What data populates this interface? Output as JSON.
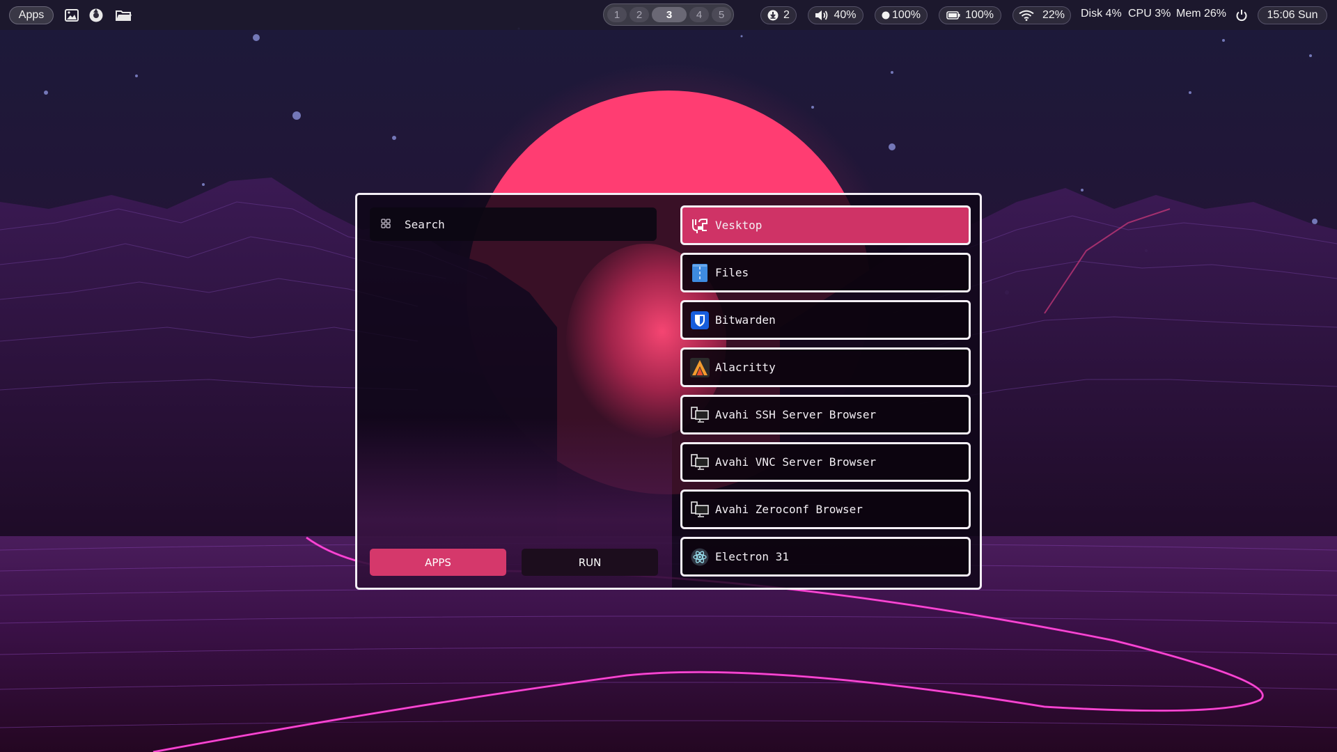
{
  "desktop": {
    "colors": {
      "sun": "#ff3d72",
      "sky": "#1c1236",
      "grid": "#7a2f9a",
      "neon": "#ff2fd2"
    }
  },
  "topbar": {
    "apps_label": "Apps",
    "quick_icons": [
      "image-icon",
      "camera-icon",
      "folder-icon"
    ],
    "workspaces": [
      "1",
      "2",
      "3",
      "4",
      "5"
    ],
    "active_workspace": "3",
    "updates": {
      "icon": "download-icon",
      "value": "2"
    },
    "volume": {
      "icon": "volume-icon",
      "value": "40%"
    },
    "brightness": {
      "icon": "brightness-icon",
      "value": "100%"
    },
    "battery": {
      "icon": "battery-icon",
      "value": "100%"
    },
    "wifi": {
      "icon": "wifi-icon",
      "value": "22%"
    },
    "disk": "Disk 4%",
    "cpu": "CPU 3%",
    "mem": "Mem 26%",
    "power_icon": "power-icon",
    "clock": "15:06 Sun"
  },
  "launcher": {
    "search_placeholder": "Search",
    "tabs": [
      {
        "label": "APPS",
        "active": true
      },
      {
        "label": "RUN",
        "active": false
      }
    ],
    "results": [
      {
        "label": "Vesktop",
        "icon": "vesktop-icon",
        "selected": true
      },
      {
        "label": "Files",
        "icon": "files-icon",
        "selected": false
      },
      {
        "label": "Bitwarden",
        "icon": "bitwarden-icon",
        "selected": false
      },
      {
        "label": "Alacritty",
        "icon": "alacritty-icon",
        "selected": false
      },
      {
        "label": "Avahi SSH Server Browser",
        "icon": "network-computer-icon",
        "selected": false
      },
      {
        "label": "Avahi VNC Server Browser",
        "icon": "network-computer-icon",
        "selected": false
      },
      {
        "label": "Avahi Zeroconf Browser",
        "icon": "network-computer-icon",
        "selected": false
      },
      {
        "label": "Electron 31",
        "icon": "electron-icon",
        "selected": false
      }
    ],
    "accent": "#d5386b"
  }
}
